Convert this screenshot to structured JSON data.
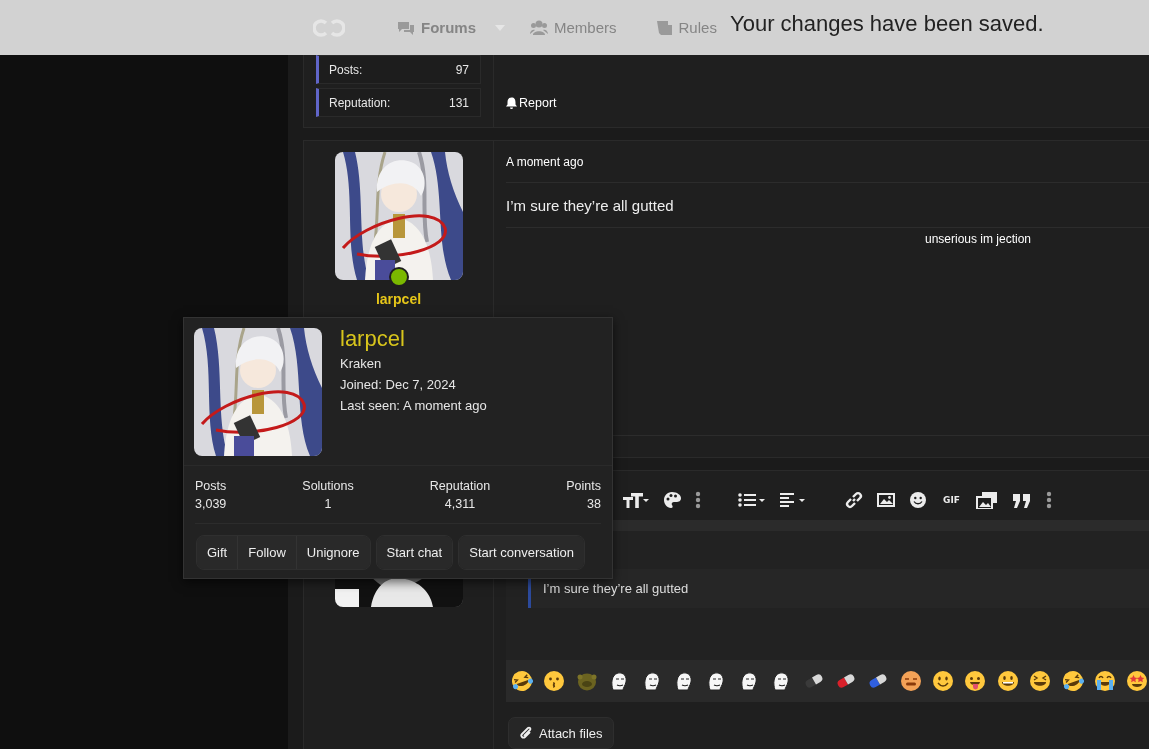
{
  "header": {
    "nav": [
      {
        "label": "Forums",
        "menu": true
      },
      {
        "label": "Members",
        "menu": false
      },
      {
        "label": "Rules",
        "menu": false
      }
    ]
  },
  "toast": {
    "message": "Your changes have been saved."
  },
  "previous_post": {
    "user_stats": [
      {
        "label": "Posts:",
        "value": "97"
      },
      {
        "label": "Reputation:",
        "value": "131"
      }
    ],
    "report": "Report"
  },
  "post": {
    "author": {
      "name": "larpcel",
      "online": true
    },
    "time": "A moment ago",
    "message": "I’m sure they’re all gutted",
    "signature": "unserious im jection"
  },
  "member_card": {
    "name": "larpcel",
    "title": "Kraken",
    "joined": "Joined: Dec 7, 2024",
    "last_seen": "Last seen: A moment ago",
    "stats": [
      {
        "label": "Posts",
        "value": "3,039"
      },
      {
        "label": "Solutions",
        "value": "1"
      },
      {
        "label": "Reputation",
        "value": "4,311"
      },
      {
        "label": "Points",
        "value": "38"
      }
    ],
    "button_groups": [
      [
        "Gift",
        "Follow",
        "Unignore"
      ],
      [
        "Start chat"
      ],
      [
        "Start conversation"
      ]
    ]
  },
  "reply_editor": {
    "gif_label": "GIF",
    "quote": "I’m sure they’re all gutted",
    "smilies": [
      {
        "kind": "laughing"
      },
      {
        "kind": "kissing"
      },
      {
        "kind": "blob"
      },
      {
        "kind": "sketch"
      },
      {
        "kind": "sketch"
      },
      {
        "kind": "sketch"
      },
      {
        "kind": "sketch"
      },
      {
        "kind": "sketch"
      },
      {
        "kind": "sketch"
      },
      {
        "kind": "pill",
        "color": "#3a3a3a"
      },
      {
        "kind": "pill",
        "color": "#d8202a"
      },
      {
        "kind": "pill",
        "color": "#2f5fe0"
      },
      {
        "kind": "flat"
      },
      {
        "kind": "smile"
      },
      {
        "kind": "tongue"
      },
      {
        "kind": "grin"
      },
      {
        "kind": "squint"
      },
      {
        "kind": "laughing"
      },
      {
        "kind": "tears"
      },
      {
        "kind": "starstruck"
      }
    ],
    "attach_button": "Attach files"
  }
}
